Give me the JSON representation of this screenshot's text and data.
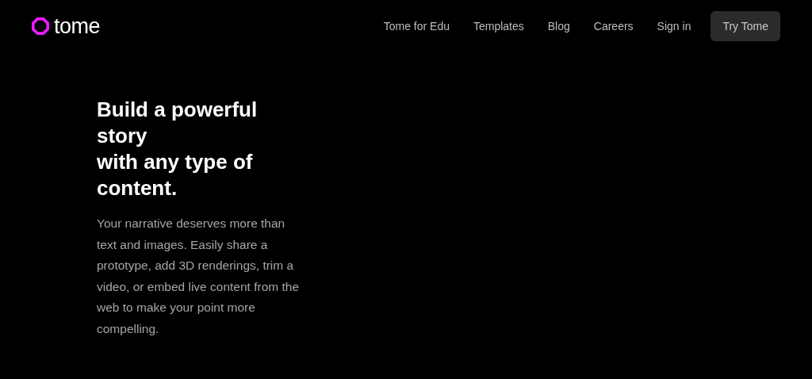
{
  "logo": {
    "text": "tome"
  },
  "nav": [
    {
      "label": "Tome for Edu",
      "kind": "link"
    },
    {
      "label": "Templates",
      "kind": "link"
    },
    {
      "label": "Blog",
      "kind": "link"
    },
    {
      "label": "Careers",
      "kind": "link"
    },
    {
      "label": "Sign in",
      "kind": "link"
    },
    {
      "label": "Try Tome",
      "kind": "button"
    }
  ],
  "hero": {
    "headline_lines": [
      "Build a powerful story",
      "with any type of content."
    ],
    "body": "Your narrative deserves more than text and images. Easily share a prototype, add 3D renderings, trim a video, or embed live content from the web to make your point more compelling."
  }
}
